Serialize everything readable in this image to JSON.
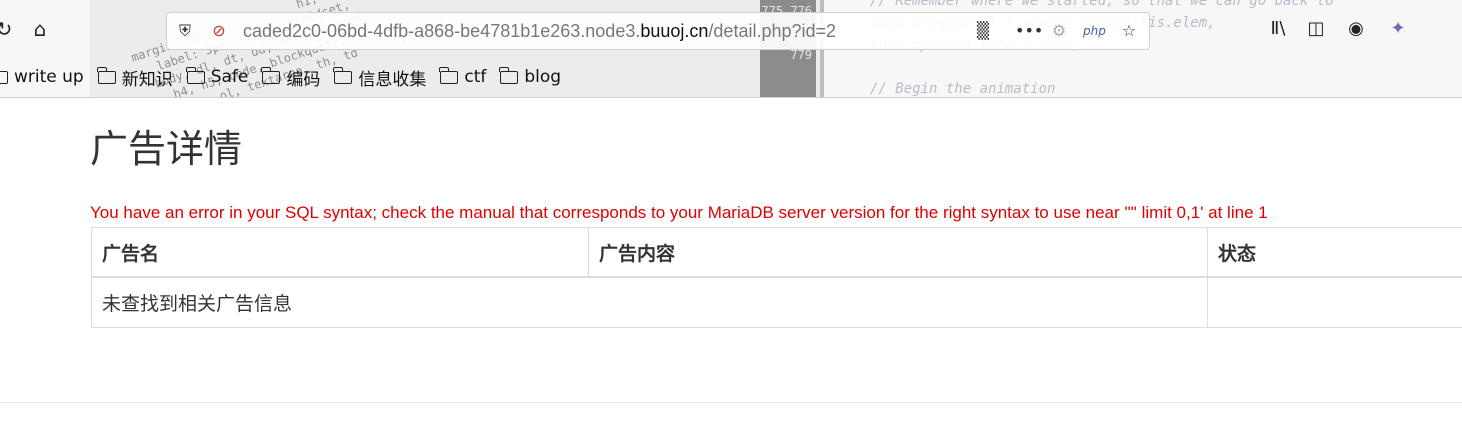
{
  "browser": {
    "url_prefix": "caded2c0-06bd-4dfb-a868-be4781b1e263.node3.",
    "url_host": "buuoj.cn",
    "url_path": "/detail.php?id=2",
    "icons": [
      "reload-icon",
      "home-icon",
      "shield-icon",
      "no-camera-icon",
      "qr-code-icon",
      "more-icon",
      "extension-icon",
      "php-icon",
      "bookmark-star-icon",
      "library-icon",
      "sidebar-icon",
      "account-icon",
      "extension-puzzle-icon"
    ],
    "php_label": "php"
  },
  "bookmarks": [
    {
      "label": "write up"
    },
    {
      "label": "新知识"
    },
    {
      "label": "Safe"
    },
    {
      "label": "编码"
    },
    {
      "label": "信息收集"
    },
    {
      "label": "ctf"
    },
    {
      "label": "blog"
    }
  ],
  "page": {
    "title": "广告详情",
    "error": "You have an error in your SQL syntax; check the manual that corresponds to your MariaDB server version for the right syntax to use near '\"' limit 0,1' at line 1",
    "table": {
      "headers": [
        "广告名",
        "广告内容",
        "状态"
      ],
      "rows": [
        [
          "未查找到相关广告信息",
          "",
          ""
        ]
      ]
    }
  },
  "colors": {
    "error": "#e00000",
    "text": "#333333"
  }
}
